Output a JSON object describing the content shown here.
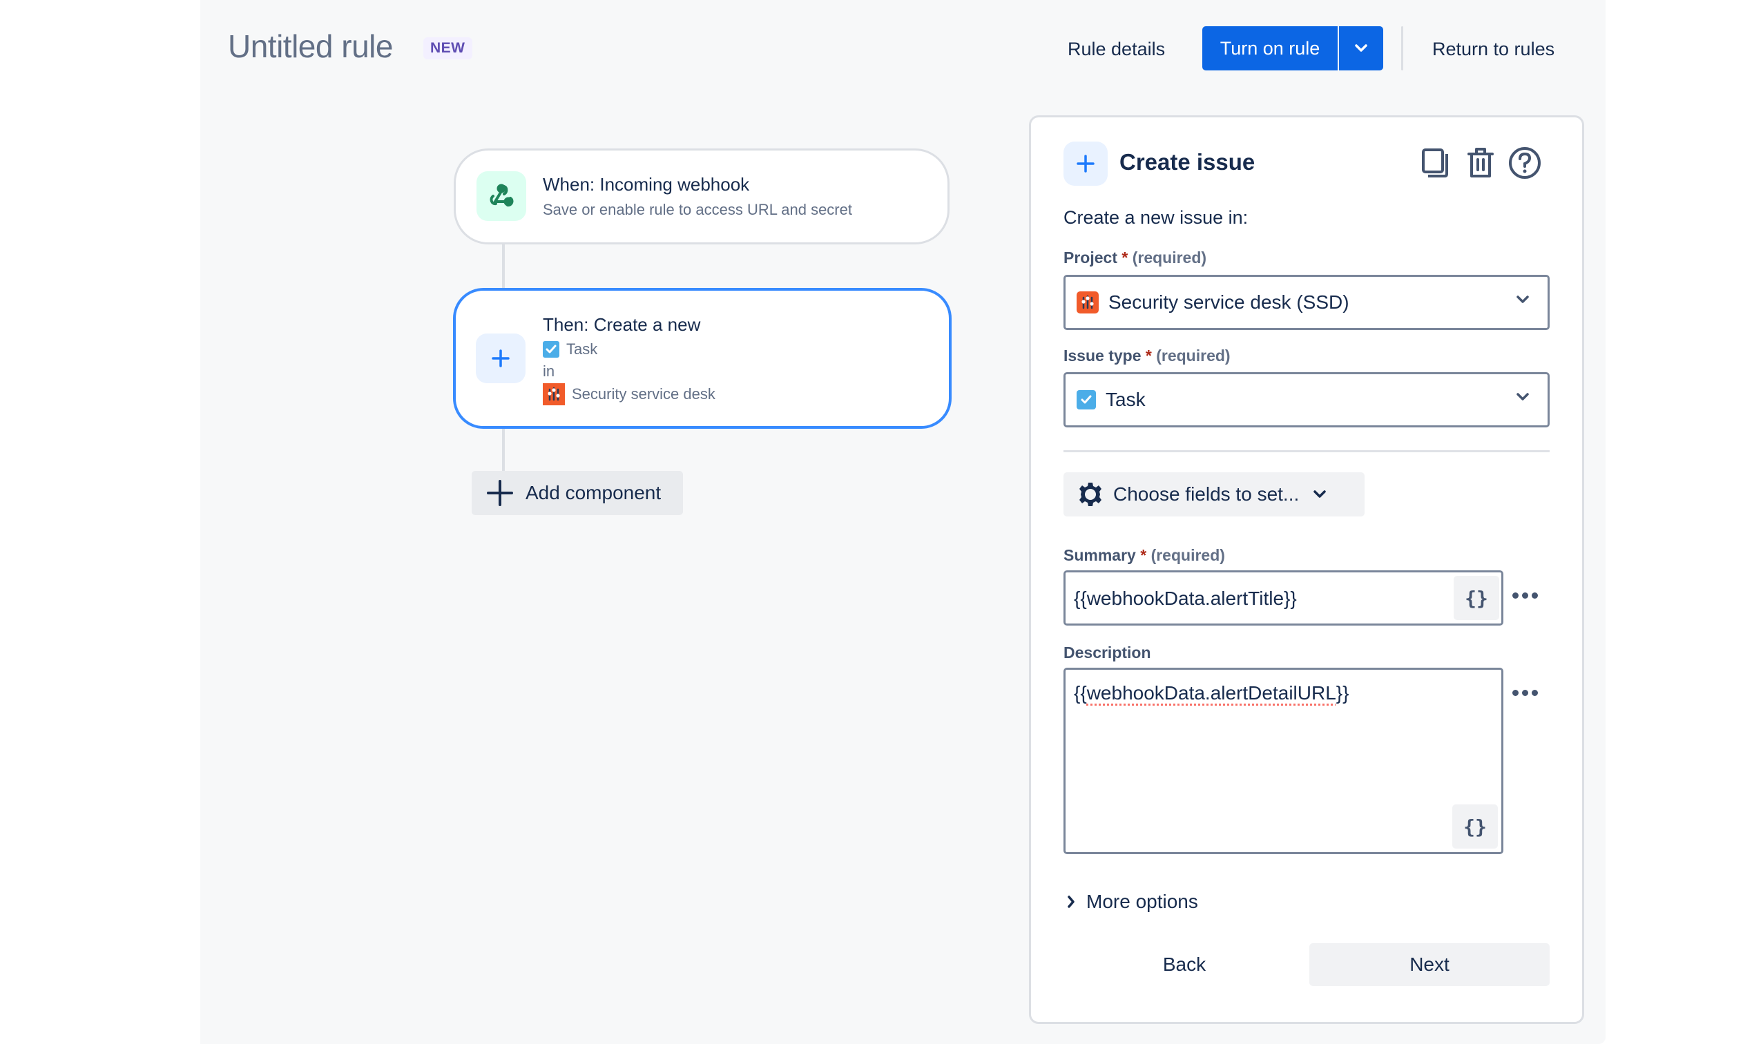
{
  "header": {
    "title": "Untitled rule",
    "badge": "NEW",
    "rule_details_label": "Rule details",
    "turn_on_label": "Turn on rule",
    "return_label": "Return to rules"
  },
  "flow": {
    "trigger": {
      "icon": "webhook-icon",
      "title": "When: Incoming webhook",
      "subtitle": "Save or enable rule to access URL and secret"
    },
    "action": {
      "icon": "plus-icon",
      "title": "Then: Create a new",
      "issue_type": "Task",
      "connector_word": "in",
      "project": "Security service desk"
    },
    "add_component_label": "Add component"
  },
  "panel": {
    "title": "Create issue",
    "header_icons": [
      "duplicate-icon",
      "trash-icon",
      "help-icon"
    ],
    "intro": "Create a new issue in:",
    "project": {
      "label": "Project",
      "required_marker": "*",
      "required_text": "(required)",
      "value": "Security service desk (SSD)"
    },
    "issue_type": {
      "label": "Issue type",
      "required_marker": "*",
      "required_text": "(required)",
      "value": "Task"
    },
    "choose_fields_label": "Choose fields to set...",
    "summary": {
      "label": "Summary",
      "required_marker": "*",
      "required_text": "(required)",
      "value": "{{webhookData.alertTitle}}",
      "smart_value_button": "{}"
    },
    "description": {
      "label": "Description",
      "value_prefix": "{{",
      "value_core": "webhookData.alertDetailURL",
      "value_suffix": "}}",
      "smart_value_button": "{}"
    },
    "more_options_label": "More options",
    "back_label": "Back",
    "next_label": "Next"
  },
  "colors": {
    "primary": "#0C66E4",
    "selected_border": "#388BFF",
    "badge_bg": "#F3F0FF",
    "badge_text": "#5E4DB2",
    "webhook_green": "#1F845A",
    "project_orange": "#F15B2A",
    "task_blue": "#4BADE8",
    "required_red": "#AE2A19"
  }
}
